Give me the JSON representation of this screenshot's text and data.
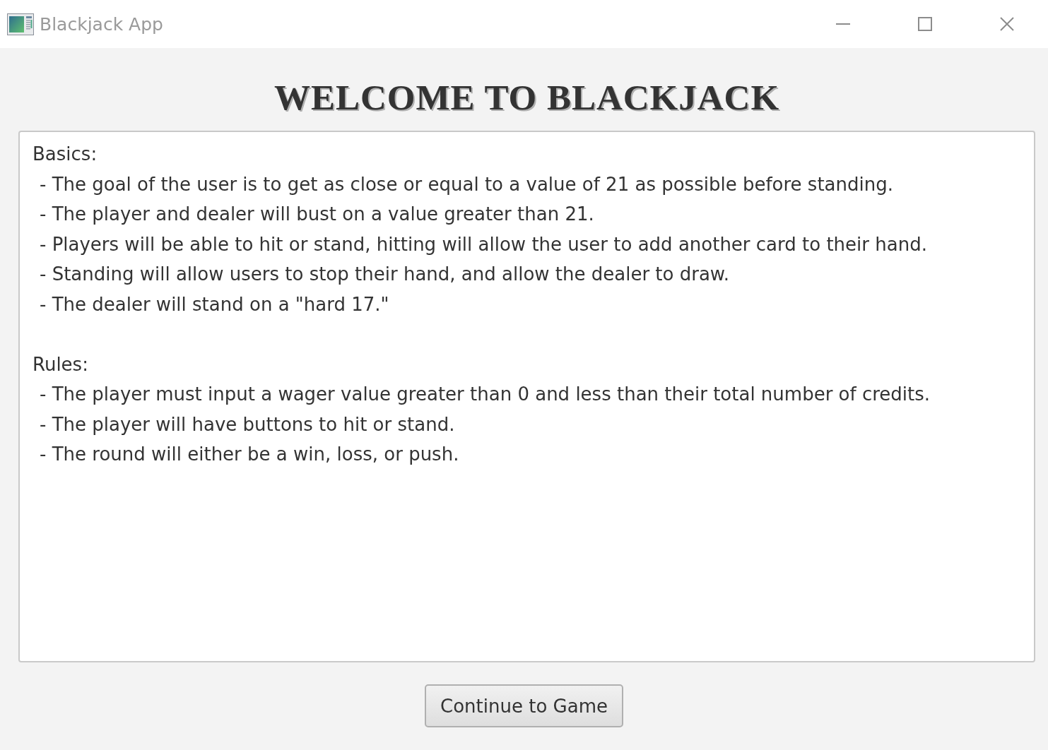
{
  "window": {
    "title": "Blackjack App"
  },
  "heading": "WELCOME TO BLACKJACK",
  "rules_text": {
    "sections": [
      {
        "heading": "Basics:",
        "items": [
          "- The goal of the user is to get as close or equal to a value of 21 as possible before standing.",
          "- The player and dealer will bust on a value greater than 21.",
          "- Players will be able to hit or stand, hitting will allow the user to add another card to their hand.",
          "- Standing will allow users to stop their hand, and allow the dealer to draw.",
          "- The dealer will stand on a \"hard 17.\""
        ]
      },
      {
        "heading": "Rules:",
        "items": [
          "- The player must input a wager value greater than 0 and less than their total number of credits.",
          "- The player will have buttons to hit or stand.",
          "- The round will either be a win, loss, or push."
        ]
      }
    ]
  },
  "buttons": [
    {
      "label": "Continue to Game"
    }
  ]
}
